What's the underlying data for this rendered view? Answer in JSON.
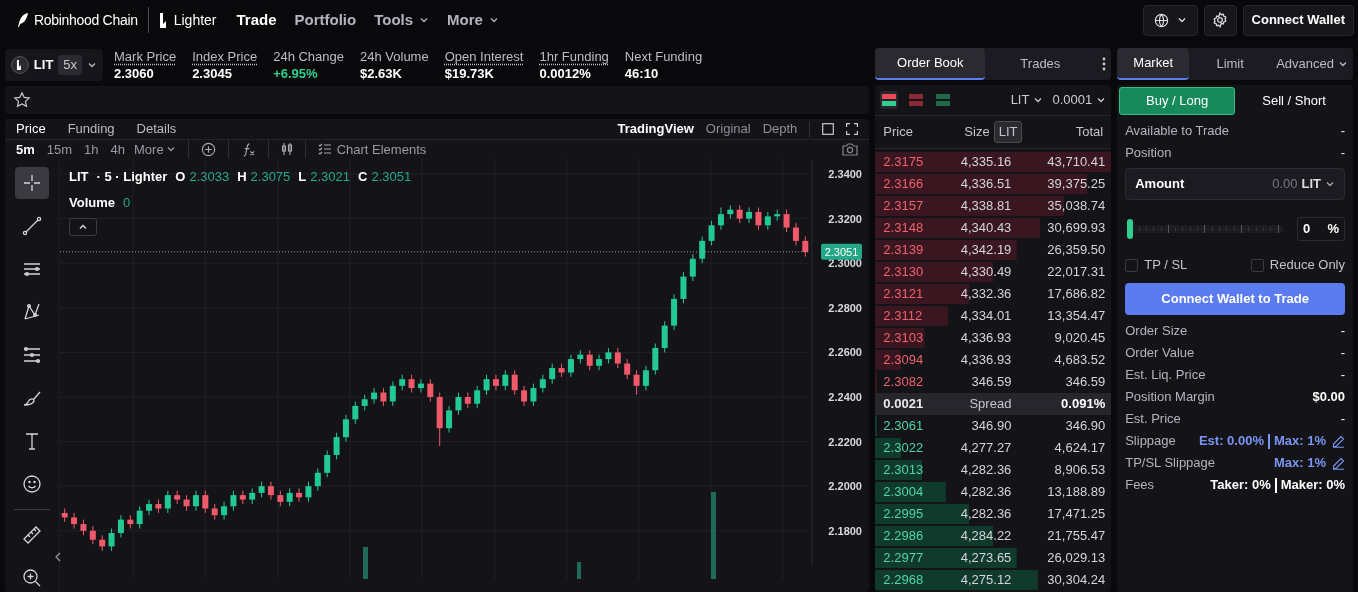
{
  "nav": {
    "brand": "Robinhood Chain",
    "product": "Lighter",
    "links": [
      {
        "label": "Trade",
        "selected": true,
        "dropdown": false
      },
      {
        "label": "Portfolio",
        "selected": false,
        "dropdown": false
      },
      {
        "label": "Tools",
        "selected": false,
        "dropdown": true
      },
      {
        "label": "More",
        "selected": false,
        "dropdown": true
      }
    ],
    "connect_button": "Connect Wallet"
  },
  "market": {
    "symbol": "LIT",
    "leverage": "5x",
    "stats": [
      {
        "label": "Mark Price",
        "value": "2.3060",
        "underlined": true,
        "up": false
      },
      {
        "label": "Index Price",
        "value": "2.3045",
        "underlined": true,
        "up": false
      },
      {
        "label": "24h Change",
        "value": "+6.95%",
        "underlined": false,
        "up": true
      },
      {
        "label": "24h Volume",
        "value": "$2.63K",
        "underlined": false,
        "up": false
      },
      {
        "label": "Open Interest",
        "value": "$19.73K",
        "underlined": true,
        "up": false
      },
      {
        "label": "1hr Funding",
        "value": "0.0012%",
        "underlined": true,
        "up": false
      },
      {
        "label": "Next Funding",
        "value": "46:10",
        "underlined": false,
        "up": false
      }
    ]
  },
  "chart_panel": {
    "tabs": [
      {
        "label": "Price",
        "selected": true
      },
      {
        "label": "Funding",
        "selected": false
      },
      {
        "label": "Details",
        "selected": false
      }
    ],
    "views": [
      {
        "label": "TradingView",
        "selected": true
      },
      {
        "label": "Original",
        "selected": false
      },
      {
        "label": "Depth",
        "selected": false
      }
    ],
    "timeframes": [
      {
        "label": "5m",
        "selected": true
      },
      {
        "label": "15m",
        "selected": false
      },
      {
        "label": "1h",
        "selected": false
      },
      {
        "label": "4h",
        "selected": false
      }
    ],
    "more": "More",
    "chart_elements": "Chart Elements",
    "tools": [
      {
        "kind": "crosshair",
        "selected": true
      },
      {
        "kind": "trendline",
        "selected": false
      },
      {
        "kind": "hlines",
        "selected": false
      },
      {
        "kind": "pattern",
        "selected": false
      },
      {
        "kind": "fib",
        "selected": false
      },
      {
        "kind": "brush",
        "selected": false
      },
      {
        "kind": "text",
        "selected": false
      },
      {
        "kind": "emoji",
        "selected": false
      },
      {
        "kind": "ruler",
        "selected": false
      },
      {
        "kind": "zoom",
        "selected": false
      }
    ],
    "legend": {
      "symbol": "LIT",
      "meta": "· 5 · Lighter",
      "ohlc": [
        {
          "key": "O",
          "value": "2.3033"
        },
        {
          "key": "H",
          "value": "2.3075"
        },
        {
          "key": "L",
          "value": "2.3021"
        },
        {
          "key": "C",
          "value": "2.3051"
        }
      ],
      "volume_label": "Volume",
      "volume_value": "0"
    },
    "chart_data": {
      "type": "candlestick",
      "grid": true,
      "ylim": [
        2.165,
        2.346
      ],
      "yticks": [
        {
          "value": 2.18,
          "label": "2.1800"
        },
        {
          "value": 2.2,
          "label": "2.2000"
        },
        {
          "value": 2.22,
          "label": "2.2200"
        },
        {
          "value": 2.24,
          "label": "2.2400"
        },
        {
          "value": 2.26,
          "label": "2.2600"
        },
        {
          "value": 2.28,
          "label": "2.2800"
        },
        {
          "value": 2.3,
          "label": "2.3000"
        },
        {
          "value": 2.32,
          "label": "2.3200"
        },
        {
          "value": 2.34,
          "label": "2.3400"
        }
      ],
      "ref_lines": [
        {
          "axis": "y",
          "value": 2.3051,
          "label": "2.3051"
        }
      ],
      "ohlc": [
        [
          2.188,
          2.19,
          2.184,
          2.186
        ],
        [
          2.186,
          2.188,
          2.181,
          2.183
        ],
        [
          2.183,
          2.185,
          2.178,
          2.18
        ],
        [
          2.18,
          2.182,
          2.174,
          2.176
        ],
        [
          2.176,
          2.178,
          2.171,
          2.173
        ],
        [
          2.173,
          2.181,
          2.171,
          2.179
        ],
        [
          2.179,
          2.187,
          2.177,
          2.185
        ],
        [
          2.185,
          2.187,
          2.181,
          2.183
        ],
        [
          2.183,
          2.191,
          2.181,
          2.189
        ],
        [
          2.189,
          2.194,
          2.187,
          2.192
        ],
        [
          2.192,
          2.194,
          2.188,
          2.19
        ],
        [
          2.19,
          2.198,
          2.188,
          2.196
        ],
        [
          2.196,
          2.198,
          2.192,
          2.194
        ],
        [
          2.194,
          2.196,
          2.189,
          2.191
        ],
        [
          2.191,
          2.198,
          2.189,
          2.196
        ],
        [
          2.196,
          2.198,
          2.188,
          2.19
        ],
        [
          2.19,
          2.192,
          2.185,
          2.187
        ],
        [
          2.187,
          2.193,
          2.185,
          2.191
        ],
        [
          2.191,
          2.198,
          2.189,
          2.196
        ],
        [
          2.196,
          2.198,
          2.192,
          2.194
        ],
        [
          2.194,
          2.199,
          2.192,
          2.197
        ],
        [
          2.197,
          2.202,
          2.195,
          2.2
        ],
        [
          2.2,
          2.202,
          2.194,
          2.196
        ],
        [
          2.196,
          2.198,
          2.191,
          2.193
        ],
        [
          2.193,
          2.199,
          2.191,
          2.197
        ],
        [
          2.197,
          2.199,
          2.193,
          2.195
        ],
        [
          2.195,
          2.202,
          2.193,
          2.2
        ],
        [
          2.2,
          2.208,
          2.198,
          2.206
        ],
        [
          2.206,
          2.216,
          2.204,
          2.214
        ],
        [
          2.214,
          2.224,
          2.212,
          2.222
        ],
        [
          2.222,
          2.232,
          2.22,
          2.23
        ],
        [
          2.23,
          2.238,
          2.228,
          2.236
        ],
        [
          2.236,
          2.241,
          2.234,
          2.239
        ],
        [
          2.239,
          2.244,
          2.237,
          2.242
        ],
        [
          2.242,
          2.244,
          2.236,
          2.238
        ],
        [
          2.238,
          2.247,
          2.236,
          2.245
        ],
        [
          2.245,
          2.25,
          2.243,
          2.248
        ],
        [
          2.248,
          2.25,
          2.242,
          2.244
        ],
        [
          2.244,
          2.248,
          2.242,
          2.246
        ],
        [
          2.246,
          2.248,
          2.238,
          2.24
        ],
        [
          2.24,
          2.242,
          2.218,
          2.226
        ],
        [
          2.226,
          2.236,
          2.224,
          2.234
        ],
        [
          2.234,
          2.242,
          2.232,
          2.24
        ],
        [
          2.24,
          2.242,
          2.235,
          2.237
        ],
        [
          2.237,
          2.245,
          2.235,
          2.243
        ],
        [
          2.243,
          2.25,
          2.241,
          2.248
        ],
        [
          2.248,
          2.25,
          2.243,
          2.245
        ],
        [
          2.245,
          2.252,
          2.243,
          2.25
        ],
        [
          2.25,
          2.252,
          2.241,
          2.243
        ],
        [
          2.243,
          2.245,
          2.236,
          2.238
        ],
        [
          2.238,
          2.246,
          2.236,
          2.244
        ],
        [
          2.244,
          2.25,
          2.242,
          2.248
        ],
        [
          2.248,
          2.255,
          2.246,
          2.253
        ],
        [
          2.253,
          2.255,
          2.249,
          2.251
        ],
        [
          2.251,
          2.259,
          2.249,
          2.257
        ],
        [
          2.257,
          2.261,
          2.255,
          2.259
        ],
        [
          2.259,
          2.261,
          2.252,
          2.254
        ],
        [
          2.254,
          2.259,
          2.252,
          2.257
        ],
        [
          2.257,
          2.262,
          2.255,
          2.26
        ],
        [
          2.26,
          2.262,
          2.253,
          2.255
        ],
        [
          2.255,
          2.257,
          2.248,
          2.25
        ],
        [
          2.25,
          2.252,
          2.241,
          2.245
        ],
        [
          2.245,
          2.254,
          2.243,
          2.252
        ],
        [
          2.252,
          2.264,
          2.25,
          2.262
        ],
        [
          2.262,
          2.274,
          2.26,
          2.272
        ],
        [
          2.272,
          2.286,
          2.27,
          2.284
        ],
        [
          2.284,
          2.296,
          2.282,
          2.294
        ],
        [
          2.294,
          2.304,
          2.292,
          2.302
        ],
        [
          2.302,
          2.312,
          2.3,
          2.31
        ],
        [
          2.31,
          2.319,
          2.308,
          2.317
        ],
        [
          2.317,
          2.325,
          2.315,
          2.322
        ],
        [
          2.322,
          2.326,
          2.32,
          2.324
        ],
        [
          2.324,
          2.326,
          2.318,
          2.32
        ],
        [
          2.32,
          2.325,
          2.318,
          2.323
        ],
        [
          2.323,
          2.325,
          2.315,
          2.317
        ],
        [
          2.317,
          2.323,
          2.315,
          2.321
        ],
        [
          2.321,
          2.324,
          2.319,
          2.322
        ],
        [
          2.322,
          2.324,
          2.314,
          2.316
        ],
        [
          2.316,
          2.318,
          2.308,
          2.31
        ],
        [
          2.31,
          2.312,
          2.303,
          2.305
        ]
      ]
    }
  },
  "order_book": {
    "tabs": [
      {
        "label": "Order Book",
        "selected": true
      },
      {
        "label": "Trades",
        "selected": false
      }
    ],
    "layouts": [
      {
        "kind": "both",
        "selected": true
      },
      {
        "kind": "asks",
        "selected": false
      },
      {
        "kind": "bids",
        "selected": false
      }
    ],
    "unit": "LIT",
    "tick": "0.0001",
    "columns": {
      "price": "Price",
      "size": "Size",
      "size_unit": "LIT",
      "total": "Total"
    },
    "asks": [
      {
        "price": "2.3175",
        "size": "4,335.16",
        "total": "43,710.41"
      },
      {
        "price": "2.3166",
        "size": "4,336.51",
        "total": "39,375.25"
      },
      {
        "price": "2.3157",
        "size": "4,338.81",
        "total": "35,038.74"
      },
      {
        "price": "2.3148",
        "size": "4,340.43",
        "total": "30,699.93"
      },
      {
        "price": "2.3139",
        "size": "4,342.19",
        "total": "26,359.50"
      },
      {
        "price": "2.3130",
        "size": "4,330.49",
        "total": "22,017.31"
      },
      {
        "price": "2.3121",
        "size": "4,332.36",
        "total": "17,686.82"
      },
      {
        "price": "2.3112",
        "size": "4,334.01",
        "total": "13,354.47"
      },
      {
        "price": "2.3103",
        "size": "4,336.93",
        "total": "9,020.45"
      },
      {
        "price": "2.3094",
        "size": "4,336.93",
        "total": "4,683.52"
      },
      {
        "price": "2.3082",
        "size": "346.59",
        "total": "346.59"
      }
    ],
    "spread": {
      "value": "0.0021",
      "label": "Spread",
      "percent": "0.091%"
    },
    "bids": [
      {
        "price": "2.3061",
        "size": "346.90",
        "total": "346.90"
      },
      {
        "price": "2.3022",
        "size": "4,277.27",
        "total": "4,624.17"
      },
      {
        "price": "2.3013",
        "size": "4,282.36",
        "total": "8,906.53"
      },
      {
        "price": "2.3004",
        "size": "4,282.36",
        "total": "13,188.89"
      },
      {
        "price": "2.2995",
        "size": "4,282.36",
        "total": "17,471.25"
      },
      {
        "price": "2.2986",
        "size": "4,284.22",
        "total": "21,755.47"
      },
      {
        "price": "2.2977",
        "size": "4,273.65",
        "total": "26,029.13"
      },
      {
        "price": "2.2968",
        "size": "4,275.12",
        "total": "30,304.24"
      }
    ]
  },
  "order_form": {
    "tabs": [
      {
        "label": "Market",
        "selected": true,
        "dropdown": false
      },
      {
        "label": "Limit",
        "selected": false,
        "dropdown": false
      },
      {
        "label": "Advanced",
        "selected": false,
        "dropdown": true
      }
    ],
    "sides": [
      {
        "label": "Buy / Long",
        "selected": true
      },
      {
        "label": "Sell / Short",
        "selected": false
      }
    ],
    "info": [
      {
        "label": "Available to Trade",
        "value": "-"
      },
      {
        "label": "Position",
        "value": "-"
      }
    ],
    "amount": {
      "label": "Amount",
      "placeholder": "0.00",
      "unit": "LIT"
    },
    "slider": {
      "level": 0,
      "value": "0",
      "unit": "%"
    },
    "options": [
      {
        "label": "TP / SL",
        "checked": false
      },
      {
        "label": "Reduce Only",
        "checked": false
      }
    ],
    "submit": "Connect Wallet to Trade",
    "details": [
      {
        "label": "Order Size",
        "values": [
          "-"
        ],
        "accent": false,
        "bold": false,
        "editable": false
      },
      {
        "label": "Order Value",
        "values": [
          "-"
        ],
        "accent": false,
        "bold": false,
        "editable": false
      },
      {
        "label": "Est. Liq. Price",
        "values": [
          "-"
        ],
        "accent": false,
        "bold": false,
        "editable": false
      },
      {
        "label": "Position Margin",
        "values": [
          "$0.00"
        ],
        "accent": false,
        "bold": true,
        "editable": false
      },
      {
        "label": "Est. Price",
        "values": [
          "-"
        ],
        "accent": false,
        "bold": false,
        "editable": false
      },
      {
        "label": "Slippage",
        "values": [
          "Est: 0.00%",
          "Max: 1%"
        ],
        "accent": true,
        "bold": true,
        "editable": true
      },
      {
        "label": "TP/SL Slippage",
        "values": [
          "Max: 1%"
        ],
        "accent": true,
        "bold": true,
        "editable": true
      },
      {
        "label": "Fees",
        "values": [
          "Taker: 0%",
          "Maker: 0%"
        ],
        "accent": false,
        "bold": true,
        "editable": false
      }
    ]
  }
}
